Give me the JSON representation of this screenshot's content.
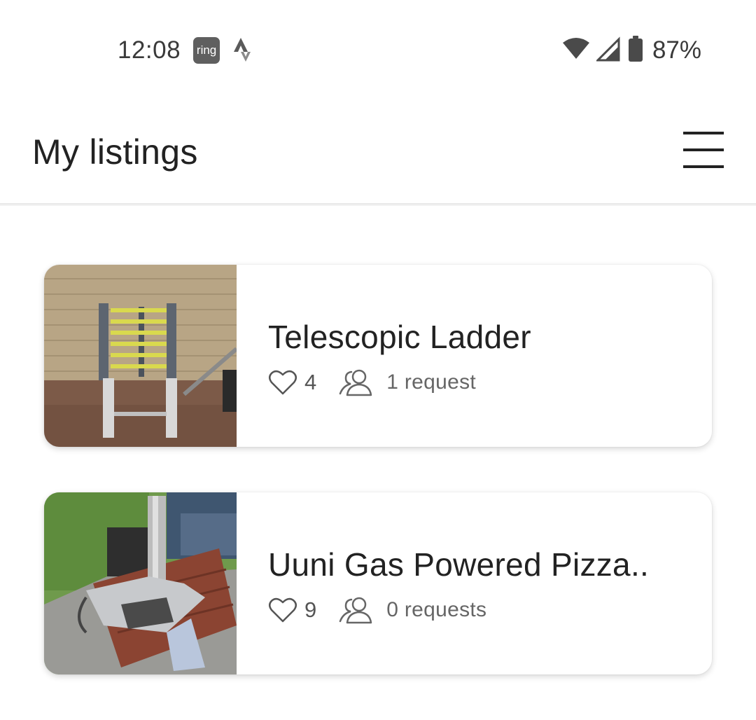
{
  "status_bar": {
    "time": "12:08",
    "ring_badge": "ring",
    "battery_percent": "87%",
    "icons": [
      "ring-app-icon",
      "strava-icon",
      "wifi-icon",
      "cell-signal-icon",
      "battery-icon"
    ]
  },
  "header": {
    "title": "My listings",
    "menu_icon": "hamburger-menu-icon"
  },
  "listings": [
    {
      "title": "Telescopic Ladder",
      "likes": "4",
      "requests": "1 request",
      "thumbnail": "telescopic-ladder-photo"
    },
    {
      "title": "Uuni Gas Powered Pizza..",
      "likes": "9",
      "requests": "0 requests",
      "thumbnail": "pizza-oven-photo"
    }
  ],
  "colors": {
    "background": "#ffffff",
    "text_primary": "#222222",
    "text_secondary": "#666666",
    "divider": "#e6e6e6"
  }
}
